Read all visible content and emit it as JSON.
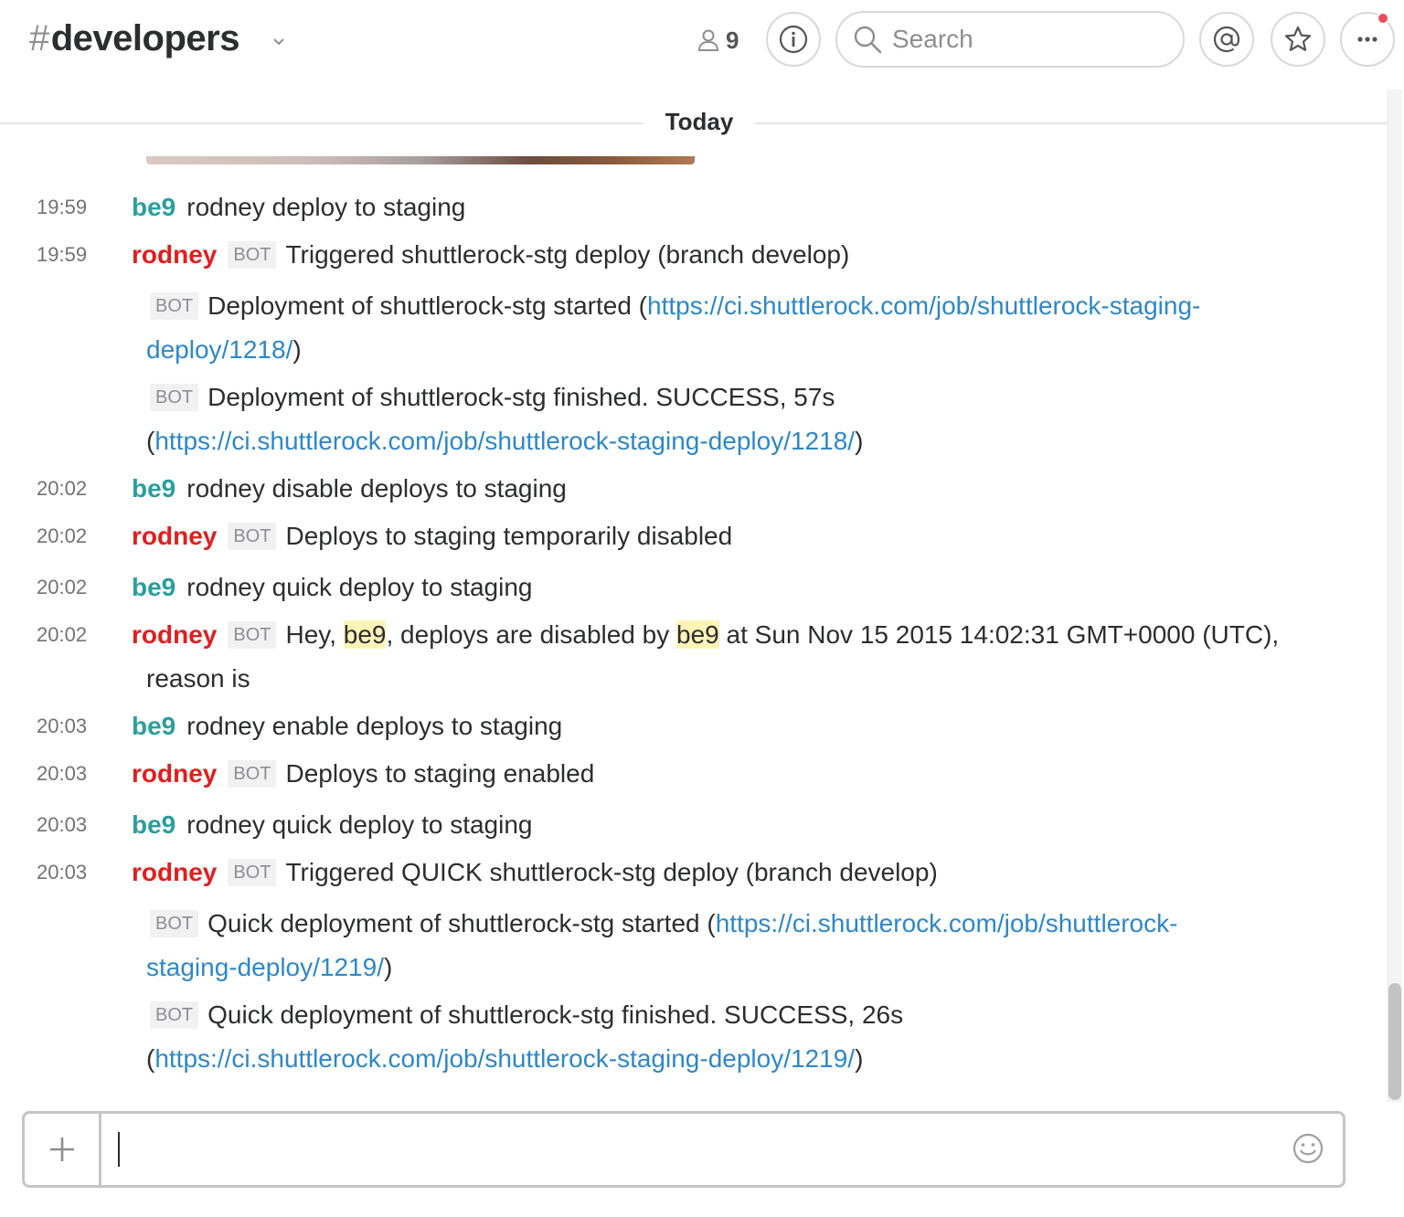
{
  "header": {
    "hash": "#",
    "channel": "developers",
    "member_count": "9",
    "search_placeholder": "Search",
    "icons": [
      "chevron-down-icon",
      "person-icon",
      "info-icon",
      "search-icon",
      "at-mention-icon",
      "star-icon",
      "more-icon"
    ],
    "notification_color": "#eb4d5c"
  },
  "divider": {
    "label": "Today"
  },
  "bot_tag": "BOT",
  "messages": [
    {
      "time": "19:59",
      "user": "be9",
      "text": "rodney deploy to staging"
    },
    {
      "time": "19:59",
      "user": "rodney",
      "text": "Triggered shuttlerock-stg deploy (branch develop)"
    },
    {
      "time": "20:02",
      "user": "be9",
      "text": "rodney disable deploys to staging"
    },
    {
      "time": "20:02",
      "user": "rodney",
      "text": "Deploys to staging temporarily disabled"
    },
    {
      "time": "20:02",
      "user": "be9",
      "text": "rodney quick deploy to staging"
    },
    {
      "time": "20:02",
      "user": "rodney",
      "text_pre": "Hey, ",
      "mention1": "be9",
      "text_mid": ", deploys are disabled by ",
      "mention2": "be9",
      "text_post": " at Sun Nov 15 2015 14:02:31 GMT+0000 (UTC),",
      "text_cont": "reason is"
    },
    {
      "time": "20:03",
      "user": "be9",
      "text": "rodney enable deploys to staging"
    },
    {
      "time": "20:03",
      "user": "rodney",
      "text": "Deploys to staging enabled"
    },
    {
      "time": "20:03",
      "user": "be9",
      "text": "rodney quick deploy to staging"
    },
    {
      "time": "20:03",
      "user": "rodney",
      "text": "Triggered QUICK shuttlerock-stg deploy (branch develop)"
    }
  ],
  "attachments": [
    {
      "text": "Deployment of shuttlerock-stg started (",
      "url_part1": "https://ci.shuttlerock.com/job/shuttlerock-staging-",
      "url_part2": "deploy/1218/",
      "close": ")"
    },
    {
      "text": "Deployment of shuttlerock-stg finished. SUCCESS, 57s",
      "open": "(",
      "url": "https://ci.shuttlerock.com/job/shuttlerock-staging-deploy/1218/",
      "close": ")"
    },
    {
      "text": "Quick deployment of shuttlerock-stg started (",
      "url_part1": "https://ci.shuttlerock.com/job/shuttlerock-",
      "url_part2": "staging-deploy/1219/",
      "close": ")"
    },
    {
      "text": "Quick deployment of shuttlerock-stg finished. SUCCESS, 26s",
      "open": "(",
      "url": "https://ci.shuttlerock.com/job/shuttlerock-staging-deploy/1219/",
      "close": ")"
    }
  ],
  "composer": {
    "icons": [
      "plus-icon",
      "emoji-icon"
    ]
  },
  "colors": {
    "be9": "#2a9e9e",
    "rodney": "#e01e1e",
    "link": "#2d87c9",
    "highlight": "#fff4b8"
  }
}
